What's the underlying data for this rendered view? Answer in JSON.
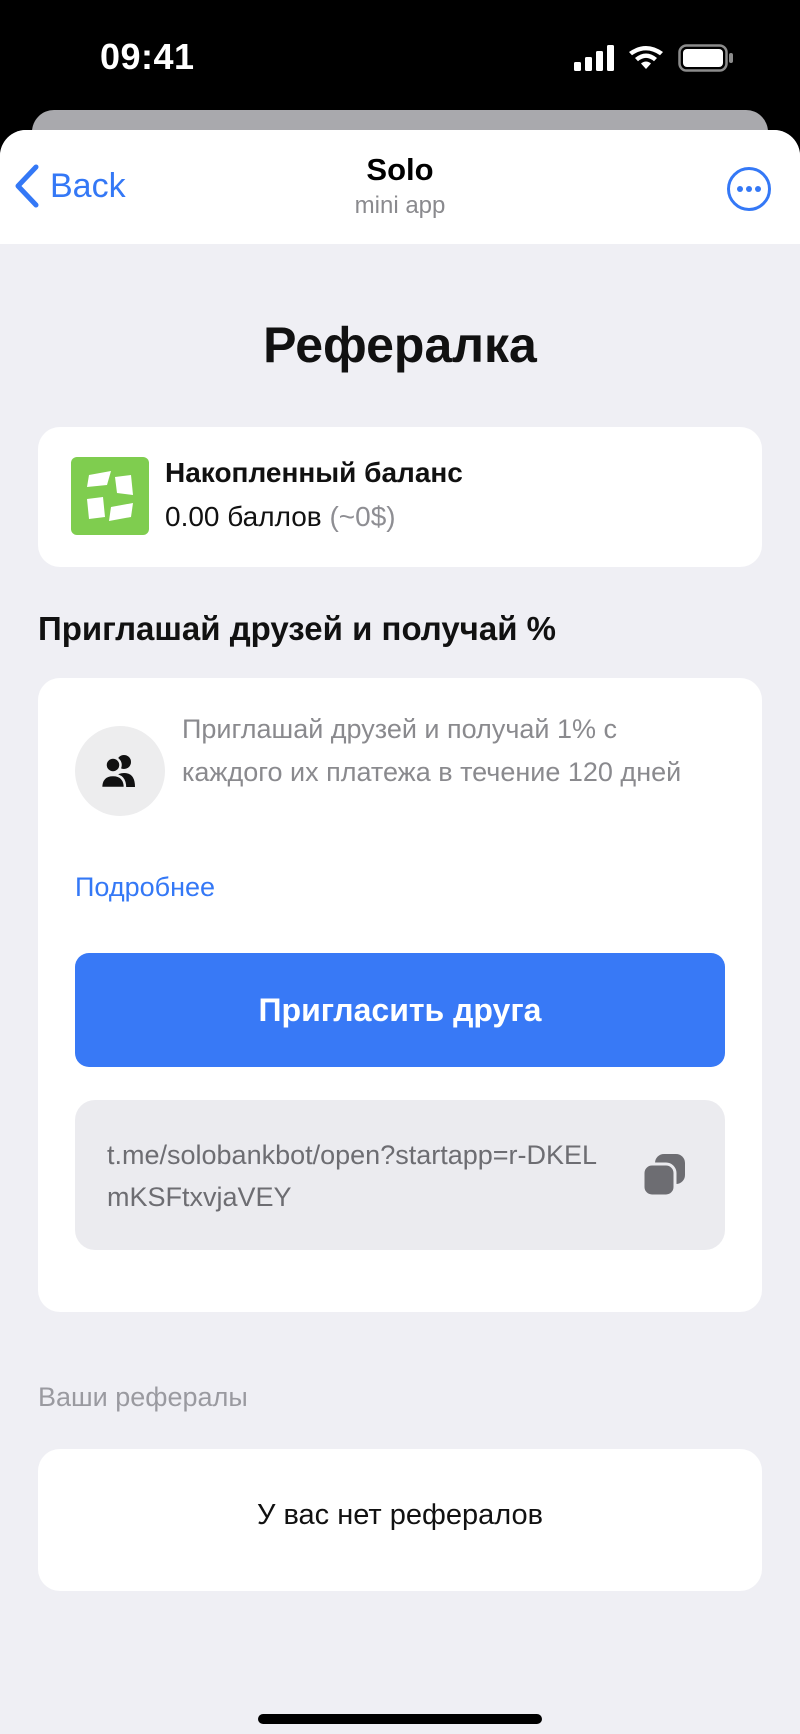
{
  "status_bar": {
    "time": "09:41",
    "icons": [
      "cellular-signal-icon",
      "wifi-icon",
      "battery-icon"
    ]
  },
  "nav": {
    "back_label": "Back",
    "title": "Solo",
    "subtitle": "mini app",
    "more_icon": "ellipsis-circle-icon"
  },
  "page": {
    "title": "Рефералка"
  },
  "balance": {
    "title": "Накопленный баланс",
    "value": "0.00 баллов",
    "usd": "(~0$)",
    "logo_color": "#7fcd4f"
  },
  "invite": {
    "heading": "Приглашай друзей и получай %",
    "description": "Приглашай друзей и получай 1% с каждого их платежа в течение 120 дней",
    "more_link": "Подробнее",
    "button_label": "Пригласить друга",
    "referral_link": "t.me/solobankbot/open?startapp=r-DKELmKSFtxvjaVEY",
    "icon": "people-icon",
    "copy_icon": "copy-icon"
  },
  "referrals": {
    "label": "Ваши рефералы",
    "empty_text": "У вас нет рефералов"
  },
  "colors": {
    "accent": "#3478f6",
    "button": "#3879f6",
    "background": "#efeff4"
  }
}
